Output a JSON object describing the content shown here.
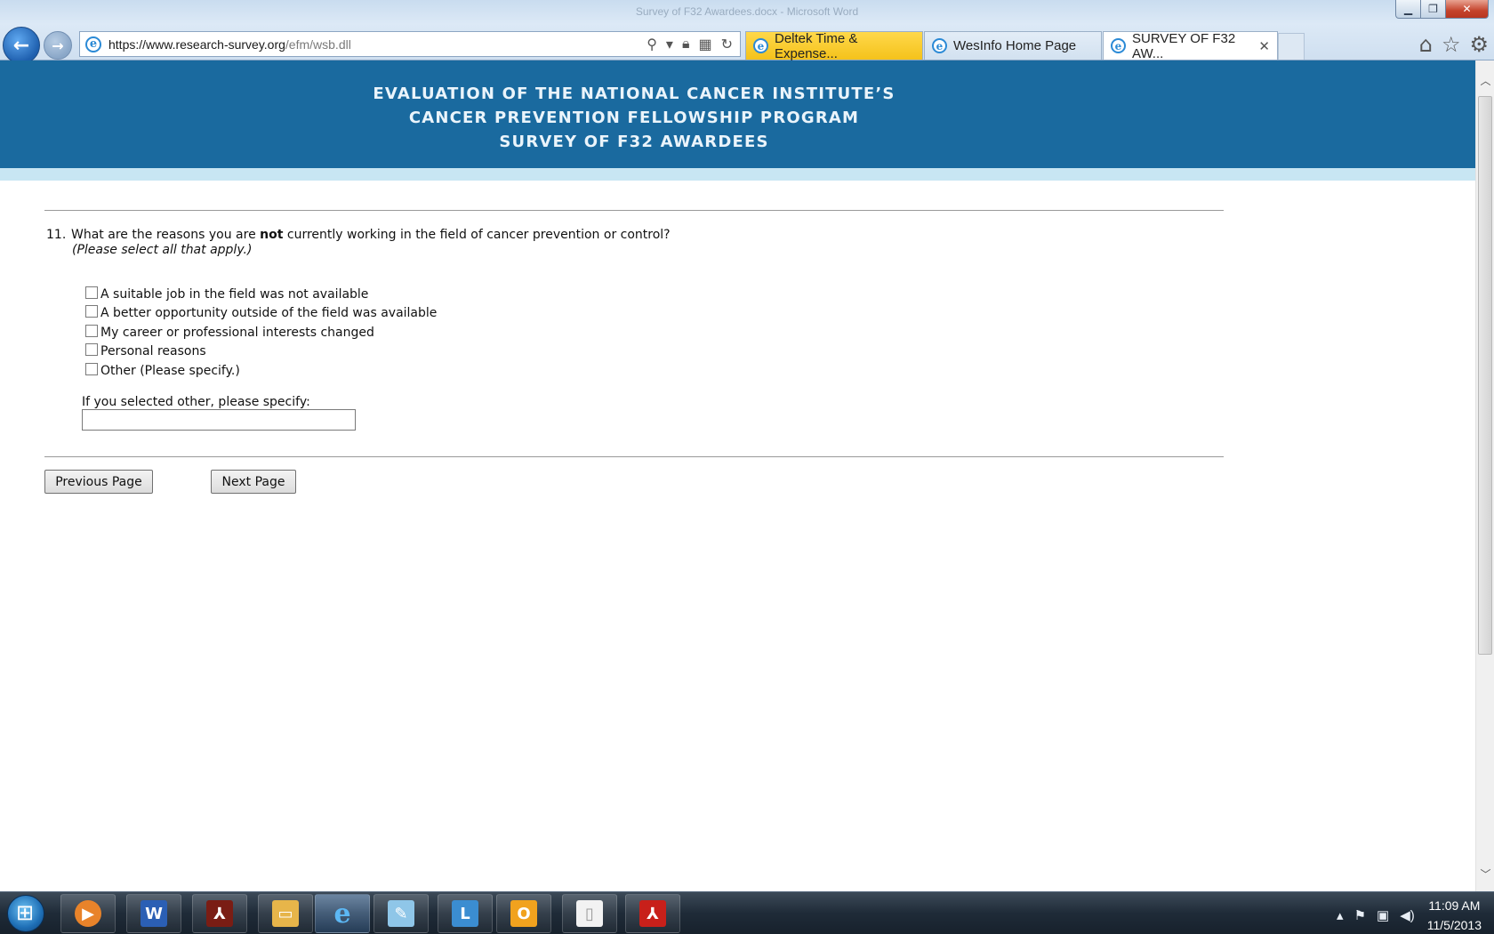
{
  "browser": {
    "window_title": "Survey of F32 Awardees.docx - Microsoft Word",
    "address_url_main": "https://www.research-survey.org",
    "address_url_rest": "/efm/wsb.dll",
    "tabs": [
      {
        "label": "Deltek Time & Expense...",
        "state": "highlighted"
      },
      {
        "label": "WesInfo Home Page",
        "state": "inactive"
      },
      {
        "label": "SURVEY OF F32 AW...",
        "state": "active"
      }
    ],
    "tab_close_glyph": "✕"
  },
  "banner": {
    "line1": "EVALUATION OF THE NATIONAL CANCER INSTITUTE’S",
    "line2": "CANCER PREVENTION FELLOWSHIP PROGRAM",
    "line3": "SURVEY OF F32 AWARDEES",
    "color": "#1a6a9f",
    "strip_color": "#c8e6f3"
  },
  "question": {
    "number": "11.",
    "text_before": "What are the reasons you are ",
    "text_bold": "not",
    "text_after": " currently working in the field of cancer prevention or control?",
    "instruction": "(Please select all that apply.)",
    "options": [
      {
        "label": "A suitable job in the field was not available",
        "checked": false
      },
      {
        "label": "A better opportunity outside of the field was available",
        "checked": false
      },
      {
        "label": "My career or professional interests changed",
        "checked": false
      },
      {
        "label": "Personal reasons",
        "checked": false
      },
      {
        "label": "Other (Please specify.)",
        "checked": false
      }
    ],
    "specify_label": "If you selected other, please specify:",
    "specify_value": ""
  },
  "navigation": {
    "previous_label": "Previous Page",
    "next_label": "Next Page"
  },
  "taskbar": {
    "apps": [
      "media-player",
      "word",
      "acrobat",
      "file-explorer",
      "internet-explorer",
      "notepad",
      "lync",
      "outlook",
      "blank-document",
      "pdf-reader"
    ],
    "time": "11:09 AM",
    "date": "11/5/2013"
  }
}
